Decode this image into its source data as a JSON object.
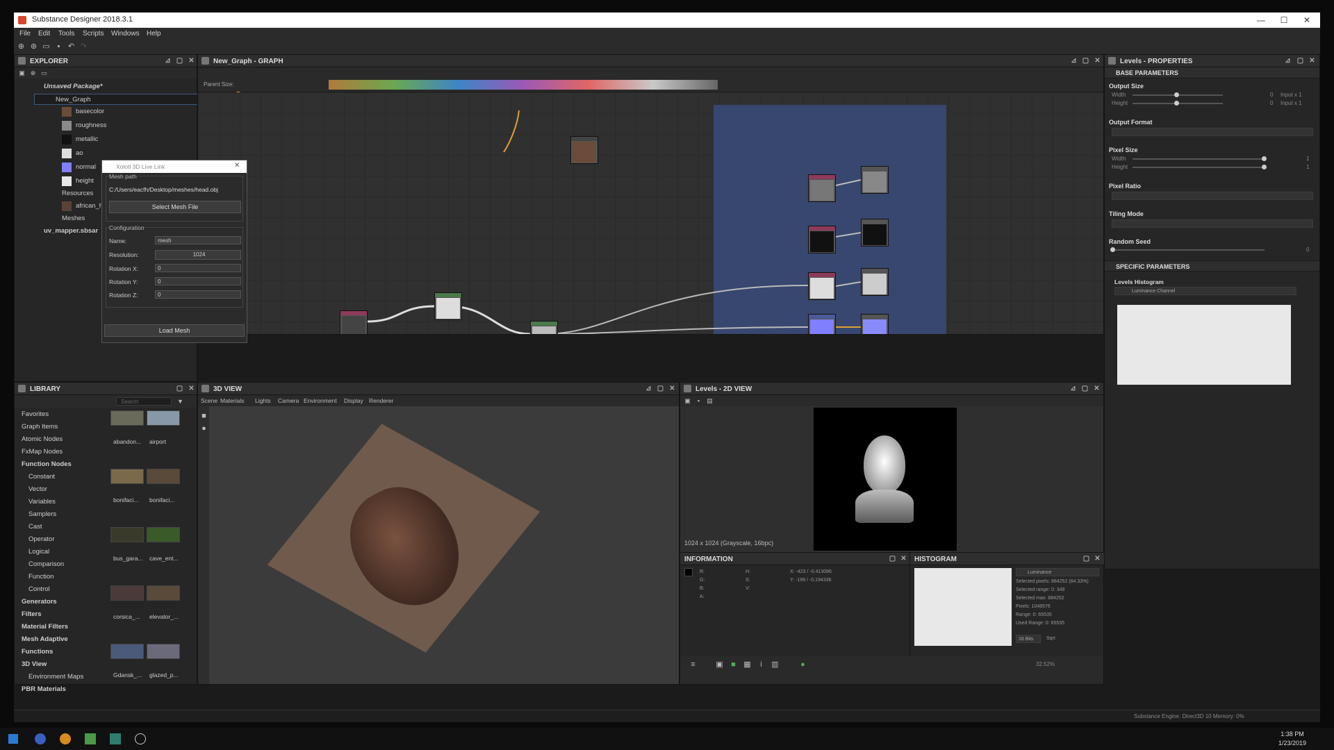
{
  "app": {
    "title": "Substance Designer 2018.3.1",
    "menu": [
      "File",
      "Edit",
      "Tools",
      "Scripts",
      "Windows",
      "Help"
    ]
  },
  "explorer": {
    "title": "EXPLORER",
    "package": "Unsaved Package*",
    "graph": "New_Graph",
    "outputs": [
      {
        "label": "basecolor",
        "color": "#6b4c3a"
      },
      {
        "label": "roughness",
        "color": "#8a8a8a"
      },
      {
        "label": "metallic",
        "color": "#111111"
      },
      {
        "label": "ao",
        "color": "#dddddd"
      },
      {
        "label": "normal",
        "color": "#8080ff"
      },
      {
        "label": "height",
        "color": "#e8e8e8"
      }
    ],
    "resources": "Resources",
    "resource_item": "african_head_",
    "meshes": "Meshes",
    "uv_mapper": "uv_mapper.sbsar"
  },
  "dialog": {
    "title": "Xolotl 3D Live Link",
    "mesh_path_label": "Mesh path",
    "mesh_path": "C:/Users/eacfh/Desktop/meshes/head.obj",
    "select_button": "Select Mesh File",
    "config_label": "Configuration",
    "name_label": "Name:",
    "name_value": "mesh",
    "resolution_label": "Resolution:",
    "resolution_value": "1024",
    "rotx_label": "Rotation X:",
    "rotx_value": "0",
    "roty_label": "Rotation Y:",
    "roty_value": "0",
    "rotz_label": "Rotation Z:",
    "rotz_value": "0",
    "load_button": "Load Mesh"
  },
  "graph_panel": {
    "title": "New_Graph - GRAPH",
    "parent_size_label": "Parent Size:"
  },
  "properties": {
    "title": "Levels - PROPERTIES",
    "base_section": "BASE PARAMETERS",
    "output_size": "Output Size",
    "width": "Width",
    "height": "Height",
    "output_size_value_w": "0",
    "output_size_value_h": "0",
    "input_w": "Input x 1",
    "input_h": "Input x 1",
    "output_format": "Output Format",
    "pixel_size": "Pixel Size",
    "pixel_size_w": "1",
    "pixel_size_h": "1",
    "pixel_ratio": "Pixel Ratio",
    "tiling_mode": "Tiling Mode",
    "random_seed": "Random Seed",
    "random_seed_value": "0",
    "specific_section": "SPECIFIC PARAMETERS",
    "levels_histogram": "Levels Histogram",
    "channel": "Luminance Channel"
  },
  "library": {
    "title": "LIBRARY",
    "search_placeholder": "Search",
    "items": [
      {
        "label": "Favorites",
        "indent": 0,
        "bold": false
      },
      {
        "label": "Graph Items",
        "indent": 0,
        "bold": false
      },
      {
        "label": "Atomic Nodes",
        "indent": 0,
        "bold": false
      },
      {
        "label": "FxMap Nodes",
        "indent": 0,
        "bold": false
      },
      {
        "label": "Function Nodes",
        "indent": 0,
        "bold": true
      },
      {
        "label": "Constant",
        "indent": 1,
        "bold": false
      },
      {
        "label": "Vector",
        "indent": 1,
        "bold": false
      },
      {
        "label": "Variables",
        "indent": 1,
        "bold": false
      },
      {
        "label": "Samplers",
        "indent": 1,
        "bold": false
      },
      {
        "label": "Cast",
        "indent": 1,
        "bold": false
      },
      {
        "label": "Operator",
        "indent": 1,
        "bold": false
      },
      {
        "label": "Logical",
        "indent": 1,
        "bold": false
      },
      {
        "label": "Comparison",
        "indent": 1,
        "bold": false
      },
      {
        "label": "Function",
        "indent": 1,
        "bold": false
      },
      {
        "label": "Control",
        "indent": 1,
        "bold": false
      },
      {
        "label": "Generators",
        "indent": 0,
        "bold": true
      },
      {
        "label": "Filters",
        "indent": 0,
        "bold": true
      },
      {
        "label": "Material Filters",
        "indent": 0,
        "bold": true
      },
      {
        "label": "Mesh Adaptive",
        "indent": 0,
        "bold": true
      },
      {
        "label": "Functions",
        "indent": 0,
        "bold": true
      },
      {
        "label": "3D View",
        "indent": 0,
        "bold": true
      },
      {
        "label": "Environment Maps",
        "indent": 1,
        "bold": false
      },
      {
        "label": "PBR Materials",
        "indent": 0,
        "bold": true
      }
    ],
    "thumbs": [
      "abandon...",
      "airport",
      "bonifaci...",
      "bonifaci...",
      "bus_gara...",
      "cave_ent...",
      "corsica_...",
      "elevator_...",
      "Gdansk_...",
      "glazed_p..."
    ]
  },
  "view3d": {
    "title": "3D VIEW",
    "tabs": [
      "Scene",
      "Materials",
      "Lights",
      "Camera",
      "Environment",
      "Display",
      "Renderer"
    ]
  },
  "view2d": {
    "title": "Levels - 2D VIEW",
    "status": "1024 x 1024 (Grayscale, 16bpc)"
  },
  "information": {
    "title": "INFORMATION",
    "r": "R:",
    "g": "G:",
    "b": "B:",
    "a": "A:",
    "h": "H:",
    "s": "S:",
    "v": "V:",
    "x": "X: -423 / -0.413086",
    "y": "Y: -199 / -0.194336"
  },
  "histogram": {
    "title": "HISTOGRAM",
    "channel": "Luminance",
    "selected_pixels": "Selected pixels:  884252 (84.33%)",
    "selected_range": "Selected range:  0: 349",
    "selected_max": "Selected max:  884252",
    "pixels": "Pixels:  1048576",
    "range": "Range:  0: 65535",
    "used_range": "Used Range:  0: 65535",
    "bits": "16 Bits",
    "sqrt": "Sqrt",
    "zoom": "32.52%"
  },
  "status": {
    "engine": "Substance Engine: Direct3D 10  Memory: 0%"
  },
  "taskbar": {
    "time": "1:38 PM",
    "date": "1/23/2019"
  }
}
